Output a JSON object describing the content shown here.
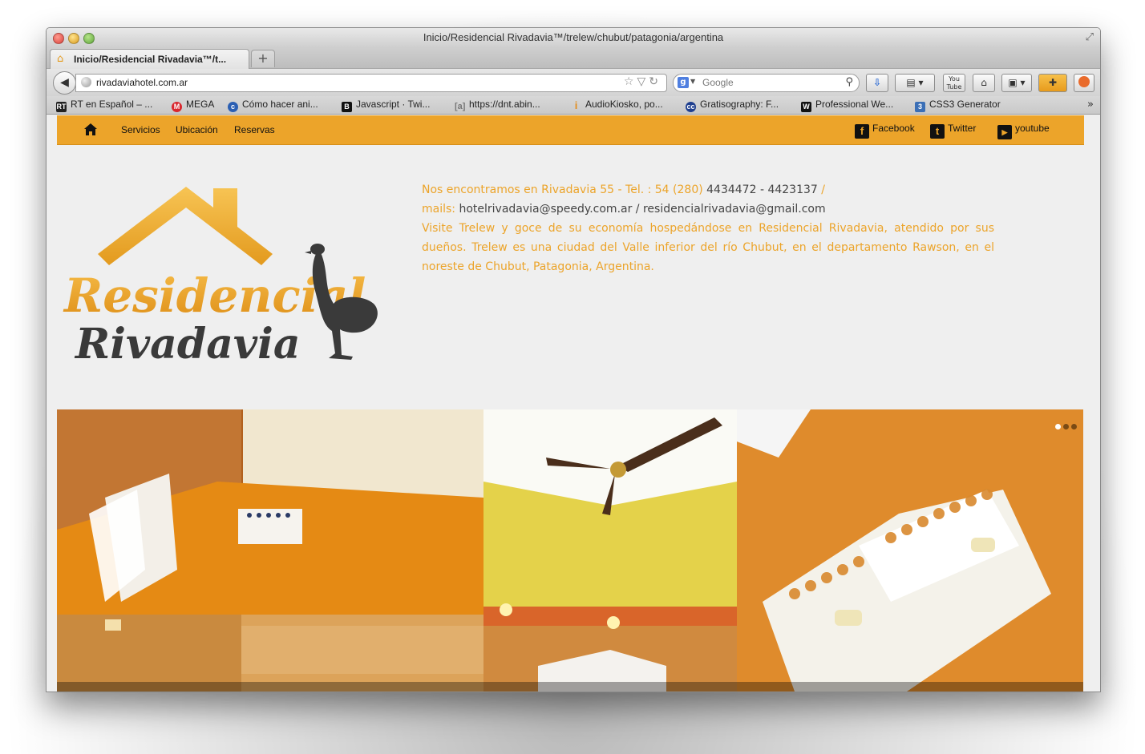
{
  "window": {
    "title": "Inicio/Residencial Rivadavia™/trelew/chubut/patagonia/argentina"
  },
  "tabs": [
    {
      "label": "Inicio/Residencial Rivadavia™/t..."
    }
  ],
  "navbar": {
    "url": "rivadaviahotel.com.ar",
    "search_placeholder": "Google"
  },
  "bookmarks": [
    {
      "label": "RT en Español – ...",
      "icon": "rt-icon",
      "color": "#222222"
    },
    {
      "label": "MEGA",
      "icon": "mega-icon",
      "color": "#d9272e"
    },
    {
      "label": "Cómo hacer ani...",
      "icon": "cl-icon",
      "color": "#2b5fb3"
    },
    {
      "label": "Javascript · Twi...",
      "icon": "b-icon",
      "color": "#111111"
    },
    {
      "label": "https://dnt.abin...",
      "icon": "a-bracket-icon",
      "color": "#8a8a8a"
    },
    {
      "label": "AudioKiosko, po...",
      "icon": "info-icon",
      "color": "#e38d1d"
    },
    {
      "label": "Gratisography: F...",
      "icon": "cc-icon",
      "color": "#1f3f8f"
    },
    {
      "label": "Professional We...",
      "icon": "w-icon",
      "color": "#111111"
    },
    {
      "label": "CSS3 Generator",
      "icon": "css3-icon",
      "color": "#3b6fb6"
    }
  ],
  "site": {
    "nav": {
      "links": [
        "Servicios",
        "Ubicación",
        "Reservas"
      ],
      "social": [
        "Facebook",
        "Twitter",
        "youtube"
      ]
    },
    "logo": {
      "line1": "Residencial",
      "line2": "Rivadavia"
    },
    "info": {
      "address": "Nos encontramos en Rivadavia 55 - Tel. : 54 (280)",
      "phones": "4434472 - 4423137",
      "sep1": " /",
      "mails_label": "mails:",
      "mail1": "hotelrivadavia@speedy.com.ar",
      "mail_sep": " / ",
      "mail2": "residencialrivadavia@gmail.com",
      "description": "Visite Trelew y goce de su economía hospedándose en Residencial Rivadavia, atendido por sus dueños. Trelew es una ciudad del Valle inferior del río Chubut, en el departamento Rawson, en el noreste de Chubut, Patagonia, Argentina."
    },
    "slider": {
      "slides": 3,
      "active": 1
    },
    "colors": {
      "accent": "#eca42a",
      "text_dark": "#444444"
    }
  }
}
